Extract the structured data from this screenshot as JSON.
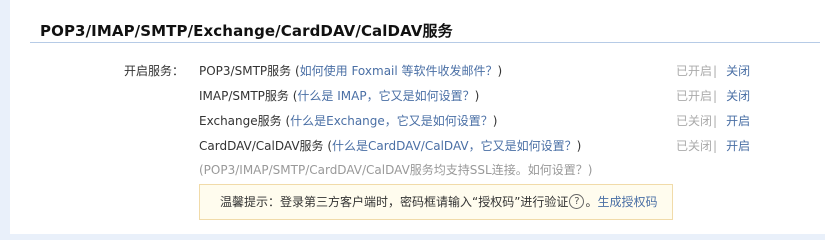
{
  "section": {
    "title": "POP3/IMAP/SMTP/Exchange/CardDAV/CalDAV服务"
  },
  "services_label": "开启服务：",
  "services": [
    {
      "name": "POP3/SMTP服务",
      "paren_open": " (",
      "help_link": "如何使用 Foxmail 等软件收发邮件？",
      "paren_close": ")",
      "status": "已开启",
      "separator": "|",
      "action": "关闭"
    },
    {
      "name": "IMAP/SMTP服务",
      "paren_open": " (",
      "help_link": "什么是 IMAP，它又是如何设置？",
      "paren_close": ")",
      "status": "已开启",
      "separator": "|",
      "action": "关闭"
    },
    {
      "name": "Exchange服务",
      "paren_open": " (",
      "help_link": "什么是Exchange，它又是如何设置？",
      "paren_close": ")",
      "status": "已关闭",
      "separator": "|",
      "action": "开启"
    },
    {
      "name": "CardDAV/CalDAV服务",
      "paren_open": " (",
      "help_link": "什么是CardDAV/CalDAV，它又是如何设置？",
      "paren_close": ")",
      "status": "已关闭",
      "separator": "|",
      "action": "开启"
    }
  ],
  "ssl_note": {
    "text": "(POP3/IMAP/SMTP/CardDAV/CalDAV服务均支持SSL连接。",
    "link": "如何设置？",
    "close": ")"
  },
  "tip": {
    "prefix": "温馨提示：登录第三方客户端时，密码框请输入“授权码”进行验证",
    "help_icon": "?",
    "suffix": "。",
    "link": "生成授权码"
  }
}
